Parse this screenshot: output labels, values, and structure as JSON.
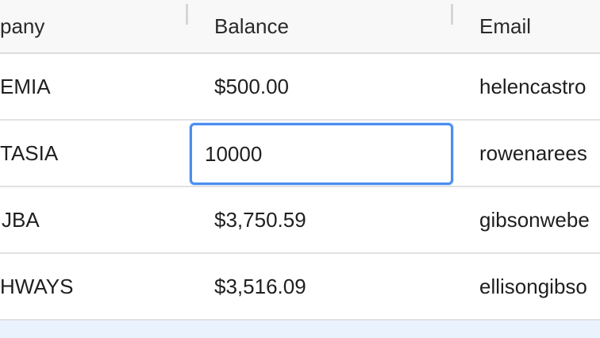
{
  "header": {
    "company": "pany",
    "balance": "Balance",
    "email": "Email"
  },
  "rows": [
    {
      "company": "EMIA",
      "balance": "$500.00",
      "email": "helencastro"
    },
    {
      "company": "TASIA",
      "balance": "10000",
      "email": "rowenarees"
    },
    {
      "company": "JBA",
      "balance": "$3,750.59",
      "email": "gibsonwebe"
    },
    {
      "company": "HWAYS",
      "balance": "$3,516.09",
      "email": "ellisongibso"
    }
  ],
  "editor": {
    "value": "10000"
  },
  "colors": {
    "focus_border": "#4a8ef0",
    "selected_row": "#eaf2fd",
    "header_bg": "#f8f8f8"
  }
}
